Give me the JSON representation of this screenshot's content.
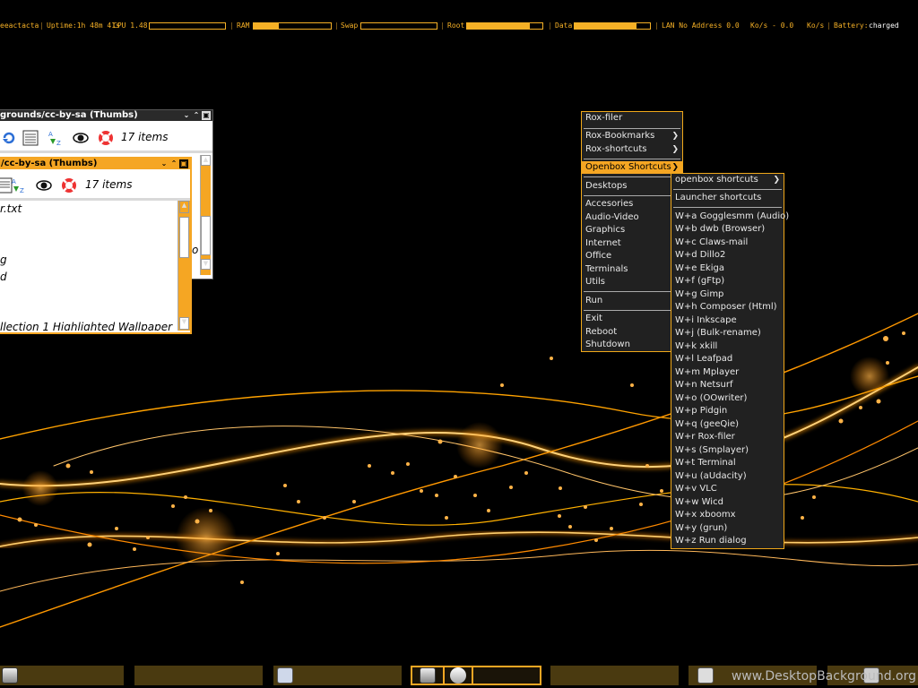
{
  "statusbar": {
    "host": "eeactacta",
    "uptime": "Uptime:1h 48m 41s",
    "cpu_label": "CPU 1.48",
    "cpu_level": 0.0,
    "ram_label": "RAM",
    "ram_level": 0.33,
    "swap_label": "Swap",
    "swap_level": 0.0,
    "root_label": "Root",
    "root_level": 0.83,
    "data_label": "Data",
    "data_level": 0.82,
    "lan": "LAN No Address 0.0",
    "rx": "Ko/s - 0.0",
    "tx_label": "Ko/s",
    "battery_label": "Battery:",
    "battery_value": "charged",
    "sep": "|",
    "color": "#f5b026"
  },
  "windows": [
    {
      "title": "grounds/cc-by-sa (Thumbs)",
      "item_count": "17 items",
      "files": []
    },
    {
      "title": "/cc-by-sa (Thumbs)",
      "item_count": "17 items",
      "files": [
        "r.txt",
        "g",
        "d",
        "llection 1 Highlighted Wallpaper"
      ],
      "extra_text": "o"
    }
  ],
  "root_menu": {
    "items": [
      {
        "label": "Rox-filer",
        "submenu": false
      },
      {
        "label": "Rox-Bookmarks",
        "submenu": true
      },
      {
        "label": "Rox-shortcuts",
        "submenu": true
      },
      {
        "label": "Openbox Shortcuts",
        "submenu": true,
        "active": true
      },
      {
        "label": "Desktops",
        "submenu": false
      },
      {
        "label": "Accesories",
        "submenu": false
      },
      {
        "label": "Audio-Video",
        "submenu": false
      },
      {
        "label": "Graphics",
        "submenu": false
      },
      {
        "label": "Internet",
        "submenu": false
      },
      {
        "label": "Office",
        "submenu": false
      },
      {
        "label": "Terminals",
        "submenu": false
      },
      {
        "label": "Utils",
        "submenu": false
      },
      {
        "label": "Run",
        "submenu": false
      },
      {
        "label": "Exit",
        "submenu": false
      },
      {
        "label": "Reboot",
        "submenu": false
      },
      {
        "label": "Shutdown",
        "submenu": false
      }
    ]
  },
  "shortcuts_menu": {
    "items": [
      {
        "label": "openbox shortcuts",
        "submenu": true
      },
      {
        "label": "Launcher shortcuts",
        "submenu": false
      },
      {
        "label": "W+a Gogglesmm (Audio)"
      },
      {
        "label": "W+b dwb (Browser)"
      },
      {
        "label": "W+c Claws-mail"
      },
      {
        "label": "W+d Dillo2"
      },
      {
        "label": "W+e Ekiga"
      },
      {
        "label": "W+f (gFtp)"
      },
      {
        "label": "W+g Gimp"
      },
      {
        "label": "W+h Composer (Html)"
      },
      {
        "label": "W+i Inkscape"
      },
      {
        "label": "W+j (Bulk-rename)"
      },
      {
        "label": "W+k xkill"
      },
      {
        "label": "W+l Leafpad"
      },
      {
        "label": "W+m Mplayer"
      },
      {
        "label": "W+n Netsurf"
      },
      {
        "label": "W+o (OOwriter)"
      },
      {
        "label": "W+p Pidgin"
      },
      {
        "label": "W+q (geeQie)"
      },
      {
        "label": "W+r Rox-filer"
      },
      {
        "label": "W+s (Smplayer)"
      },
      {
        "label": "W+t Terminal"
      },
      {
        "label": "W+u (aUdacity)"
      },
      {
        "label": "W+v VLC"
      },
      {
        "label": "W+w Wicd"
      },
      {
        "label": "W+x xboomx"
      },
      {
        "label": "W+y (grun)"
      },
      {
        "label": "W+z Run dialog"
      }
    ]
  },
  "taskbar": {
    "tasks": [
      {
        "icon": "drive-icon"
      },
      {
        "icon": ""
      },
      {
        "icon": "bird-icon"
      },
      {
        "icon": "drive-icon",
        "active": true
      },
      {
        "icon": ""
      },
      {
        "icon": "folder-icon"
      },
      {
        "icon": "folder-icon"
      }
    ]
  },
  "watermark": "www.DesktopBackground.org",
  "icons": {
    "refresh": "refresh-icon",
    "list": "list-view-icon",
    "sort": "sort-az-icon",
    "eye": "eye-icon",
    "lifebuoy": "lifebuoy-icon"
  },
  "colors": {
    "accent": "#f5a623",
    "menu_bg": "#212121"
  }
}
